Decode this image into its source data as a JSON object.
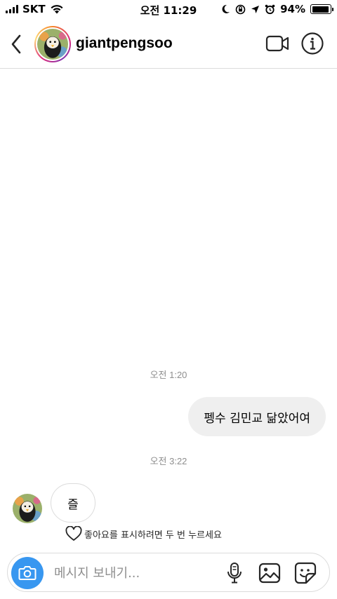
{
  "status_bar": {
    "carrier": "SKT",
    "time": "오전 11:29",
    "battery": "94%",
    "battery_level": 0.94,
    "icons": [
      "signal-icon",
      "wifi-icon",
      "moon-icon",
      "orientation-lock-icon",
      "location-icon",
      "alarm-icon",
      "battery-icon"
    ]
  },
  "header": {
    "username": "giantpengsoo",
    "icons": [
      "back-chevron-icon",
      "video-call-icon",
      "info-icon"
    ]
  },
  "messages": {
    "timestamp_1": "오전 1:20",
    "outgoing_1": "펭수 김민교 닮았어여",
    "timestamp_2": "오전 3:22",
    "incoming_1": "즐",
    "like_hint": "좋아요를 표시하려면 두 번 누르세요"
  },
  "composer": {
    "placeholder": "메시지 보내기...",
    "value": "",
    "icons": [
      "camera-icon",
      "microphone-icon",
      "gallery-icon",
      "sticker-icon"
    ]
  },
  "colors": {
    "accent_blue": "#3897f0",
    "bubble_grey": "#efefef",
    "border_grey": "#dbdbdb",
    "timestamp_grey": "#8e8e8e"
  }
}
